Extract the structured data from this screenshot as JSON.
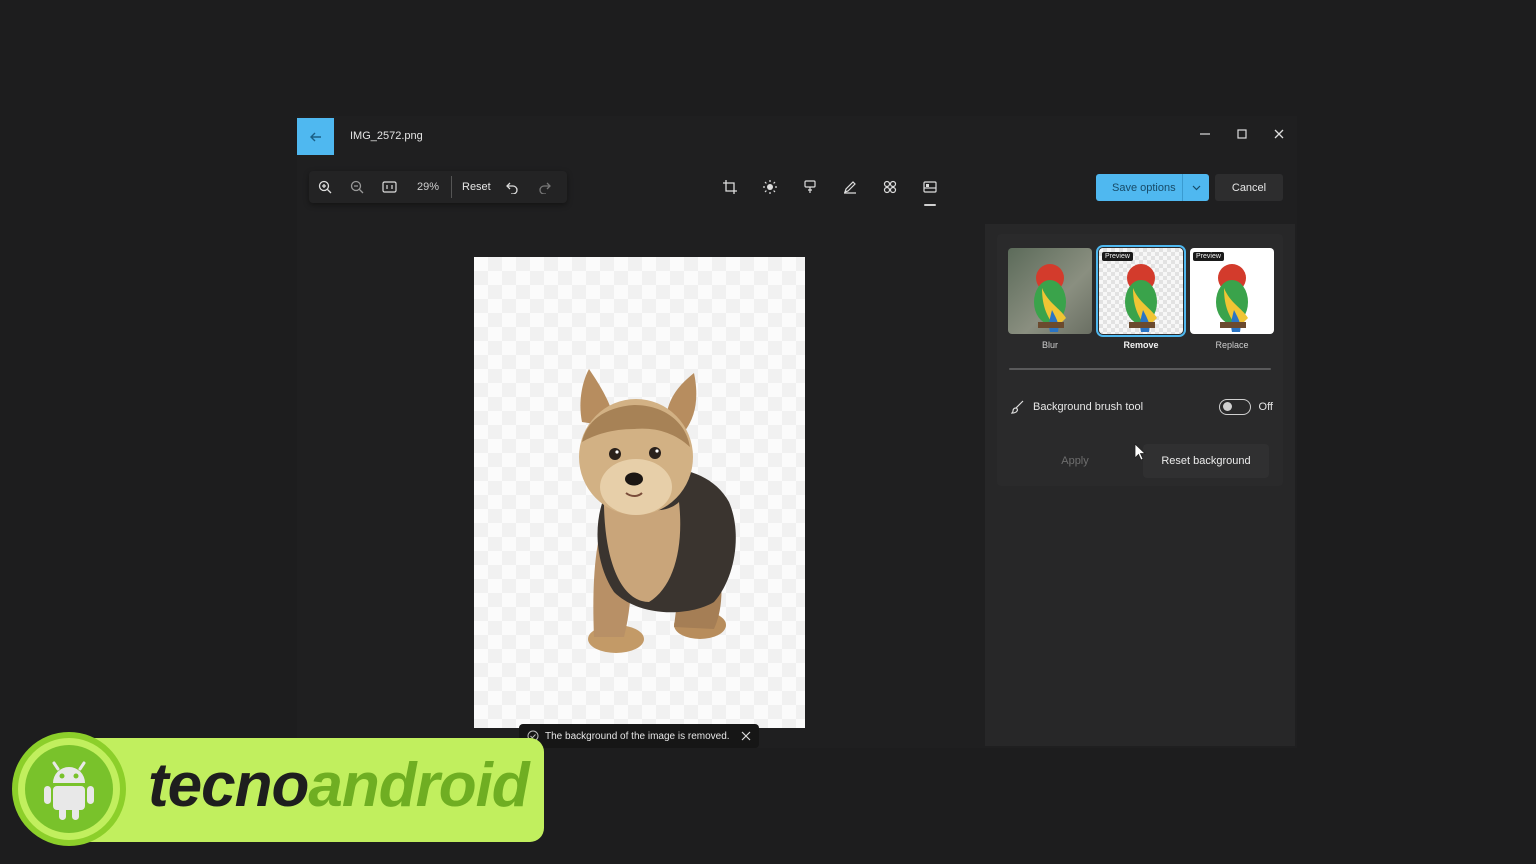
{
  "window": {
    "filename": "IMG_2572.png"
  },
  "toolbar": {
    "zoom": "29%",
    "reset_label": "Reset"
  },
  "actions": {
    "save_label": "Save options",
    "cancel_label": "Cancel"
  },
  "background_panel": {
    "options": [
      {
        "label": "Blur",
        "badge": "",
        "selected": false
      },
      {
        "label": "Remove",
        "badge": "Preview",
        "selected": true
      },
      {
        "label": "Replace",
        "badge": "Preview",
        "selected": false
      }
    ],
    "brush_tool_label": "Background brush tool",
    "brush_tool_state": "Off",
    "apply_label": "Apply",
    "reset_background_label": "Reset background"
  },
  "toast": {
    "message": "The background of the image is removed."
  },
  "watermark": {
    "part1": "tecno",
    "part2": "android"
  },
  "colors": {
    "accent": "#4fb8f0",
    "logo_green": "#c1ef5e"
  }
}
